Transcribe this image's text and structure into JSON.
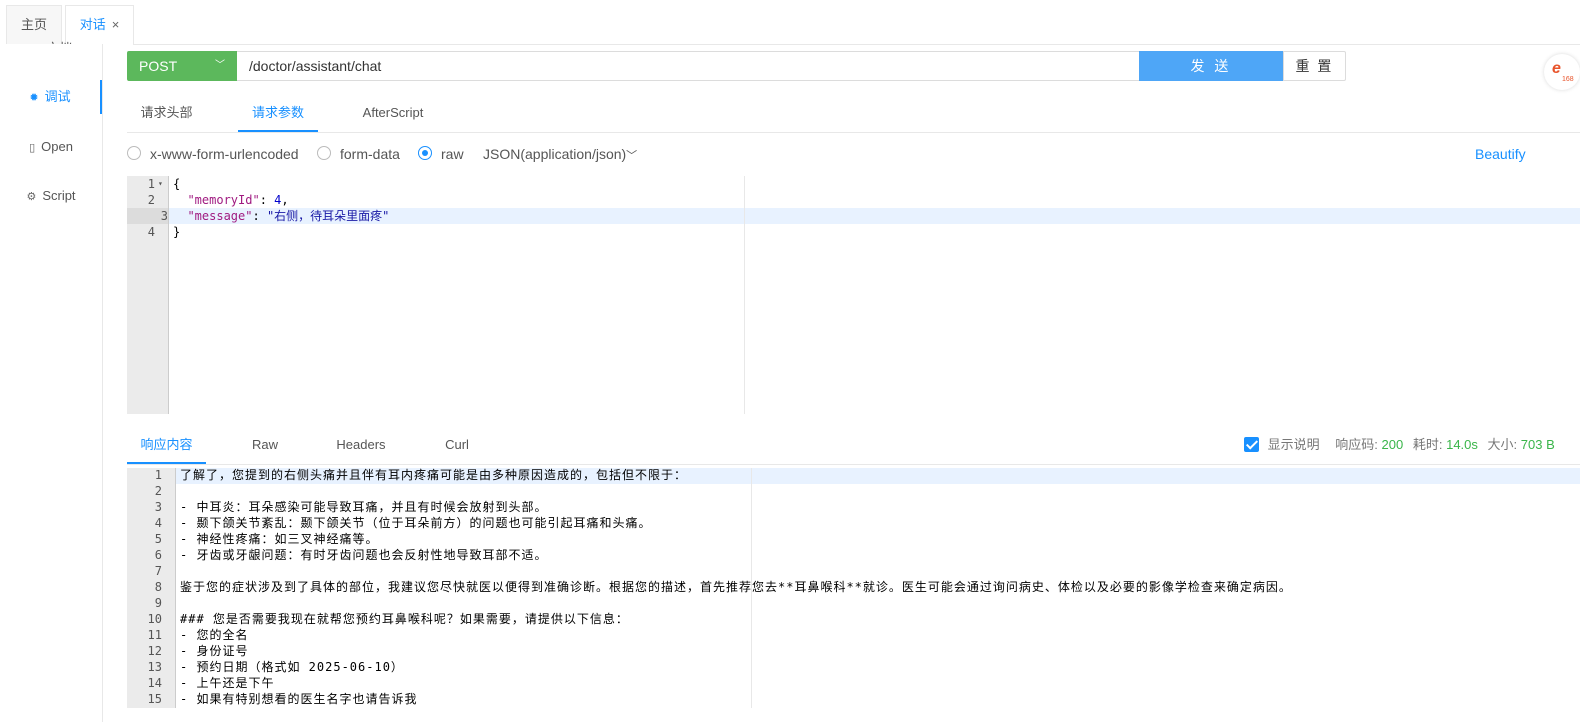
{
  "tabs": {
    "home": "主页",
    "chat": "对话",
    "close": "×"
  },
  "sidebar": {
    "items": [
      {
        "label": "文档",
        "icon": "doc-icon"
      },
      {
        "label": "调试",
        "icon": "bug-icon"
      },
      {
        "label": "Open",
        "icon": "file-icon"
      },
      {
        "label": "Script",
        "icon": "script-icon"
      }
    ]
  },
  "request": {
    "method": "POST",
    "url": "/doctor/assistant/chat",
    "send_label": "发 送",
    "reset_label": "重 置"
  },
  "request_tabs": [
    "请求头部",
    "请求参数",
    "AfterScript"
  ],
  "body_types": {
    "options": [
      "x-www-form-urlencoded",
      "form-data",
      "raw"
    ],
    "selected": "raw",
    "content_type": "JSON(application/json)",
    "beautify": "Beautify"
  },
  "request_body": {
    "line_numbers": [
      "1",
      "2",
      "3",
      "4"
    ],
    "lines": [
      {
        "parts": [
          {
            "t": "{",
            "c": ""
          }
        ]
      },
      {
        "parts": [
          {
            "t": "  ",
            "c": ""
          },
          {
            "t": "\"memoryId\"",
            "c": "key"
          },
          {
            "t": ": ",
            "c": ""
          },
          {
            "t": "4",
            "c": "num"
          },
          {
            "t": ",",
            "c": ""
          }
        ]
      },
      {
        "parts": [
          {
            "t": "  ",
            "c": ""
          },
          {
            "t": "\"message\"",
            "c": "key"
          },
          {
            "t": ": ",
            "c": ""
          },
          {
            "t": "\"右侧，待耳朵里面疼\"",
            "c": "str"
          }
        ]
      },
      {
        "parts": [
          {
            "t": "}",
            "c": ""
          }
        ]
      }
    ]
  },
  "response_tabs": [
    "响应内容",
    "Raw",
    "Headers",
    "Curl"
  ],
  "response_meta": {
    "show_desc": "显示说明",
    "status_label": "响应码:",
    "status": "200",
    "time_label": "耗时:",
    "time": "14.0s",
    "size_label": "大小:",
    "size": "703 B"
  },
  "response_body": {
    "line_numbers": [
      "1",
      "2",
      "3",
      "4",
      "5",
      "6",
      "7",
      "8",
      "9",
      "10",
      "11",
      "12",
      "13",
      "14",
      "15"
    ],
    "lines": [
      "了解了，您提到的右侧头痛并且伴有耳内疼痛可能是由多种原因造成的，包括但不限于：",
      "",
      "- 中耳炎：耳朵感染可能导致耳痛，并且有时候会放射到头部。",
      "- 颞下颌关节紊乱：颞下颌关节（位于耳朵前方）的问题也可能引起耳痛和头痛。",
      "- 神经性疼痛：如三叉神经痛等。",
      "- 牙齿或牙龈问题：有时牙齿问题也会反射性地导致耳部不适。",
      "",
      "鉴于您的症状涉及到了具体的部位，我建议您尽快就医以便得到准确诊断。根据您的描述，首先推荐您去**耳鼻喉科**就诊。医生可能会通过询问病史、体检以及必要的影像学检查来确定病因。",
      "",
      "### 您是否需要我现在就帮您预约耳鼻喉科呢？如果需要，请提供以下信息：",
      "- 您的全名",
      "- 身份证号",
      "- 预约日期（格式如 2025-06-10）",
      "- 上午还是下午",
      "- 如果有特别想看的医生名字也请告诉我"
    ]
  }
}
